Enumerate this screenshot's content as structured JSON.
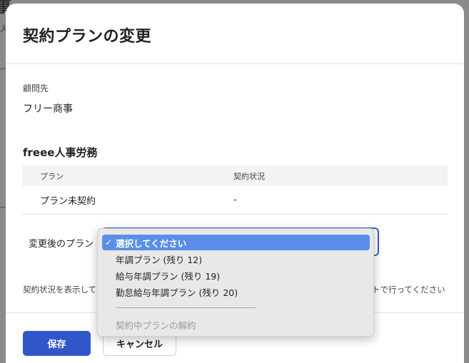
{
  "background": {
    "title_fragment": "事",
    "small_fragment": "人"
  },
  "modal": {
    "title": "契約プランの変更",
    "client_label": "顧問先",
    "client_name": "フリー商事",
    "service_title": "freee人事労務",
    "table": {
      "headers": [
        "プラン",
        "契約状況"
      ],
      "rows": [
        {
          "plan": "プラン未契約",
          "status": "-"
        }
      ]
    },
    "after_plan_label": "変更後のプラン",
    "note_left": "契約状況を表示して",
    "note_right": "トで行ってください",
    "save_label": "保存",
    "cancel_label": "キャンセル"
  },
  "dropdown": {
    "options": [
      {
        "label": "選択してください",
        "selected": true,
        "disabled": false
      },
      {
        "label": "年調プラン (残り 12)",
        "selected": false,
        "disabled": false
      },
      {
        "label": "給与年調プラン (残り 19)",
        "selected": false,
        "disabled": false
      },
      {
        "label": "勤怠給与年調プラン (残り 20)",
        "selected": false,
        "disabled": false
      },
      {
        "label": "契約中プランの解約",
        "selected": false,
        "disabled": true
      }
    ],
    "check_glyph": "✓"
  },
  "colors": {
    "primary": "#3056c9",
    "select_border": "#3b5bd6",
    "highlight": "#5a8ee8"
  }
}
